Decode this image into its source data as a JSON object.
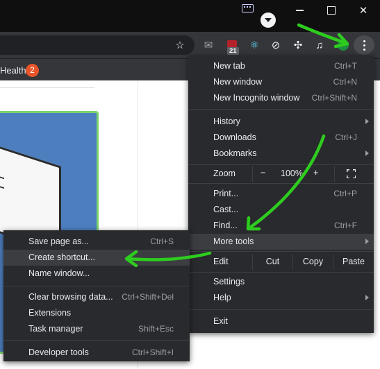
{
  "bookmark_bar": {
    "label": "Health",
    "badge": "2"
  },
  "extensions": {
    "ublock_badge": "21"
  },
  "menu": {
    "group1": [
      {
        "label": "New tab",
        "shortcut": "Ctrl+T"
      },
      {
        "label": "New window",
        "shortcut": "Ctrl+N"
      },
      {
        "label": "New Incognito window",
        "shortcut": "Ctrl+Shift+N"
      }
    ],
    "group2": [
      {
        "label": "History",
        "shortcut": ""
      },
      {
        "label": "Downloads",
        "shortcut": "Ctrl+J"
      },
      {
        "label": "Bookmarks",
        "shortcut": ""
      }
    ],
    "zoom": {
      "label": "Zoom",
      "minus": "−",
      "value": "100%",
      "plus": "+"
    },
    "group3": [
      {
        "label": "Print...",
        "shortcut": "Ctrl+P"
      },
      {
        "label": "Cast...",
        "shortcut": ""
      },
      {
        "label": "Find...",
        "shortcut": "Ctrl+F"
      },
      {
        "label": "More tools",
        "shortcut": ""
      }
    ],
    "edit": {
      "label": "Edit",
      "cut": "Cut",
      "copy": "Copy",
      "paste": "Paste"
    },
    "group4": [
      {
        "label": "Settings",
        "shortcut": ""
      },
      {
        "label": "Help",
        "shortcut": ""
      }
    ],
    "exit": {
      "label": "Exit"
    }
  },
  "submenu": {
    "group1": [
      {
        "label": "Save page as...",
        "shortcut": "Ctrl+S"
      },
      {
        "label": "Create shortcut...",
        "shortcut": ""
      },
      {
        "label": "Name window...",
        "shortcut": ""
      }
    ],
    "group2": [
      {
        "label": "Clear browsing data...",
        "shortcut": "Ctrl+Shift+Del"
      },
      {
        "label": "Extensions",
        "shortcut": ""
      },
      {
        "label": "Task manager",
        "shortcut": "Shift+Esc"
      }
    ],
    "group3": [
      {
        "label": "Developer tools",
        "shortcut": "Ctrl+Shift+I"
      }
    ]
  },
  "colors": {
    "annotation_arrow": "#2ecc1f",
    "menu_bg": "#292a2d",
    "highlight": "#3c3d41"
  }
}
